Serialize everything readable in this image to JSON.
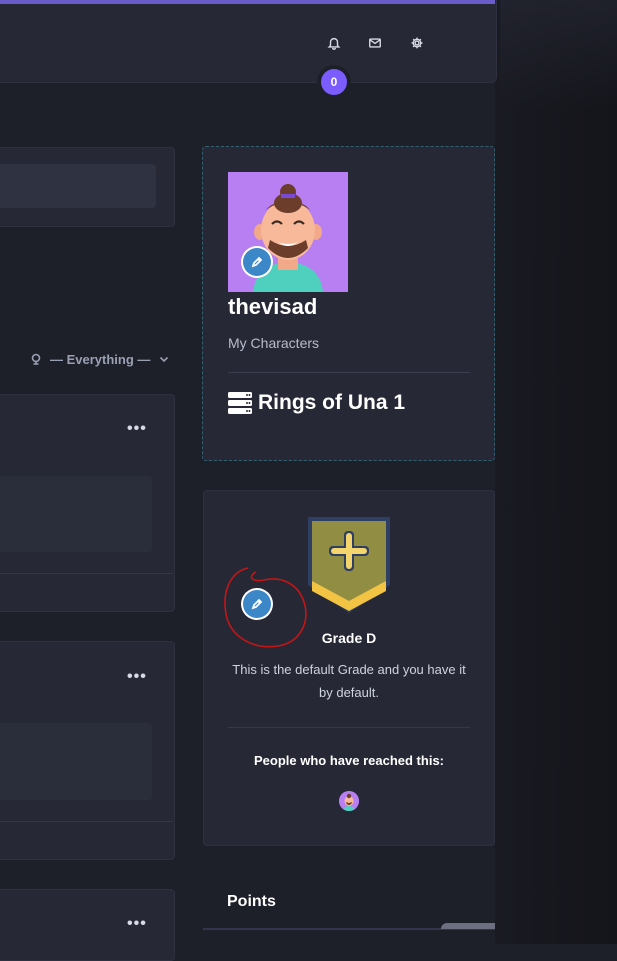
{
  "header": {
    "notifications_count": "0",
    "icons": [
      "bell-icon",
      "mail-icon",
      "gear-icon"
    ]
  },
  "feed": {
    "filter_label": "— Everything —"
  },
  "profile": {
    "username": "thevisad",
    "subtitle": "My Characters",
    "character_name": "Rings of Una 1",
    "character_icon": "server-icon",
    "avatar_bg": "#b77ff2",
    "edit_badge_color": "#3b87c8",
    "card_border_color": "#2f6170"
  },
  "grade": {
    "title": "Grade D",
    "description": "This is the default Grade and you have it by default.",
    "reached_label": "People who have reached this:",
    "badge_colors": {
      "shield": "#918d42",
      "border": "#2f3e63",
      "chevron": "#f3c343",
      "plus": "#f3d46d"
    }
  },
  "points": {
    "title": "Points"
  },
  "colors": {
    "accent": "#6b5ccc",
    "badge": "#7a5cff",
    "annotation_red": "#c41616"
  }
}
